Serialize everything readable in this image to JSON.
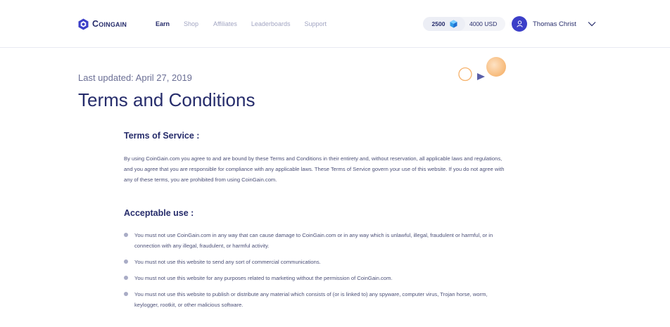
{
  "header": {
    "logo_text": "Coingain",
    "nav": [
      {
        "label": "Earn",
        "active": true
      },
      {
        "label": "Shop",
        "active": false
      },
      {
        "label": "Affiliates",
        "active": false
      },
      {
        "label": "Leaderboards",
        "active": false
      },
      {
        "label": "Support",
        "active": false
      }
    ],
    "wallet": {
      "coins": "2500",
      "coin_icon": "gem-icon",
      "usd": "4000 USD"
    },
    "user": {
      "name": "Thomas Christ",
      "avatar_icon": "user-icon",
      "menu_icon": "chevron-down-icon"
    }
  },
  "page": {
    "last_updated": "Last updated: April 27, 2019",
    "title": "Terms and Conditions",
    "terms_heading": "Terms of Service :",
    "terms_text_lines": [
      "By using CoinGain.com you agree to and are bound by these Terms and Conditions in their entirety and, without reservation, all applicable laws and regulations,",
      "and you agree that you are responsible for compliance with any applicable laws. These Terms of Service govern your use of this website. If you do not agree with",
      "any of these terms, you are prohibited from using CoinGain.com."
    ],
    "acceptable_heading": "Acceptable use :",
    "acceptable_items": [
      {
        "line1": "You must not use CoinGain.com in any way that can cause damage to CoinGain.com or in any way which is unlawful, illegal, fraudulent or harmful, or in",
        "line2": "connection with any illegal, fraudulent, or harmful activity."
      },
      {
        "line1": "You must not use this website to send any sort of commercial communications.",
        "line2": ""
      },
      {
        "line1": "You must not use this website for any purposes related to marketing without the permission of CoinGain.com.",
        "line2": ""
      },
      {
        "line1": "You must not use this website to publish or distribute any material which consists of (or is linked to) any spyware, computer virus, Trojan horse, worm,",
        "line2": "keylogger, rootkit, or other malicious software."
      }
    ]
  },
  "colors": {
    "brand_navy": "#262c6b",
    "accent_blue": "#3c3fc8",
    "nav_muted": "#a2a5c2",
    "deco_orange": "#f6b26b"
  }
}
